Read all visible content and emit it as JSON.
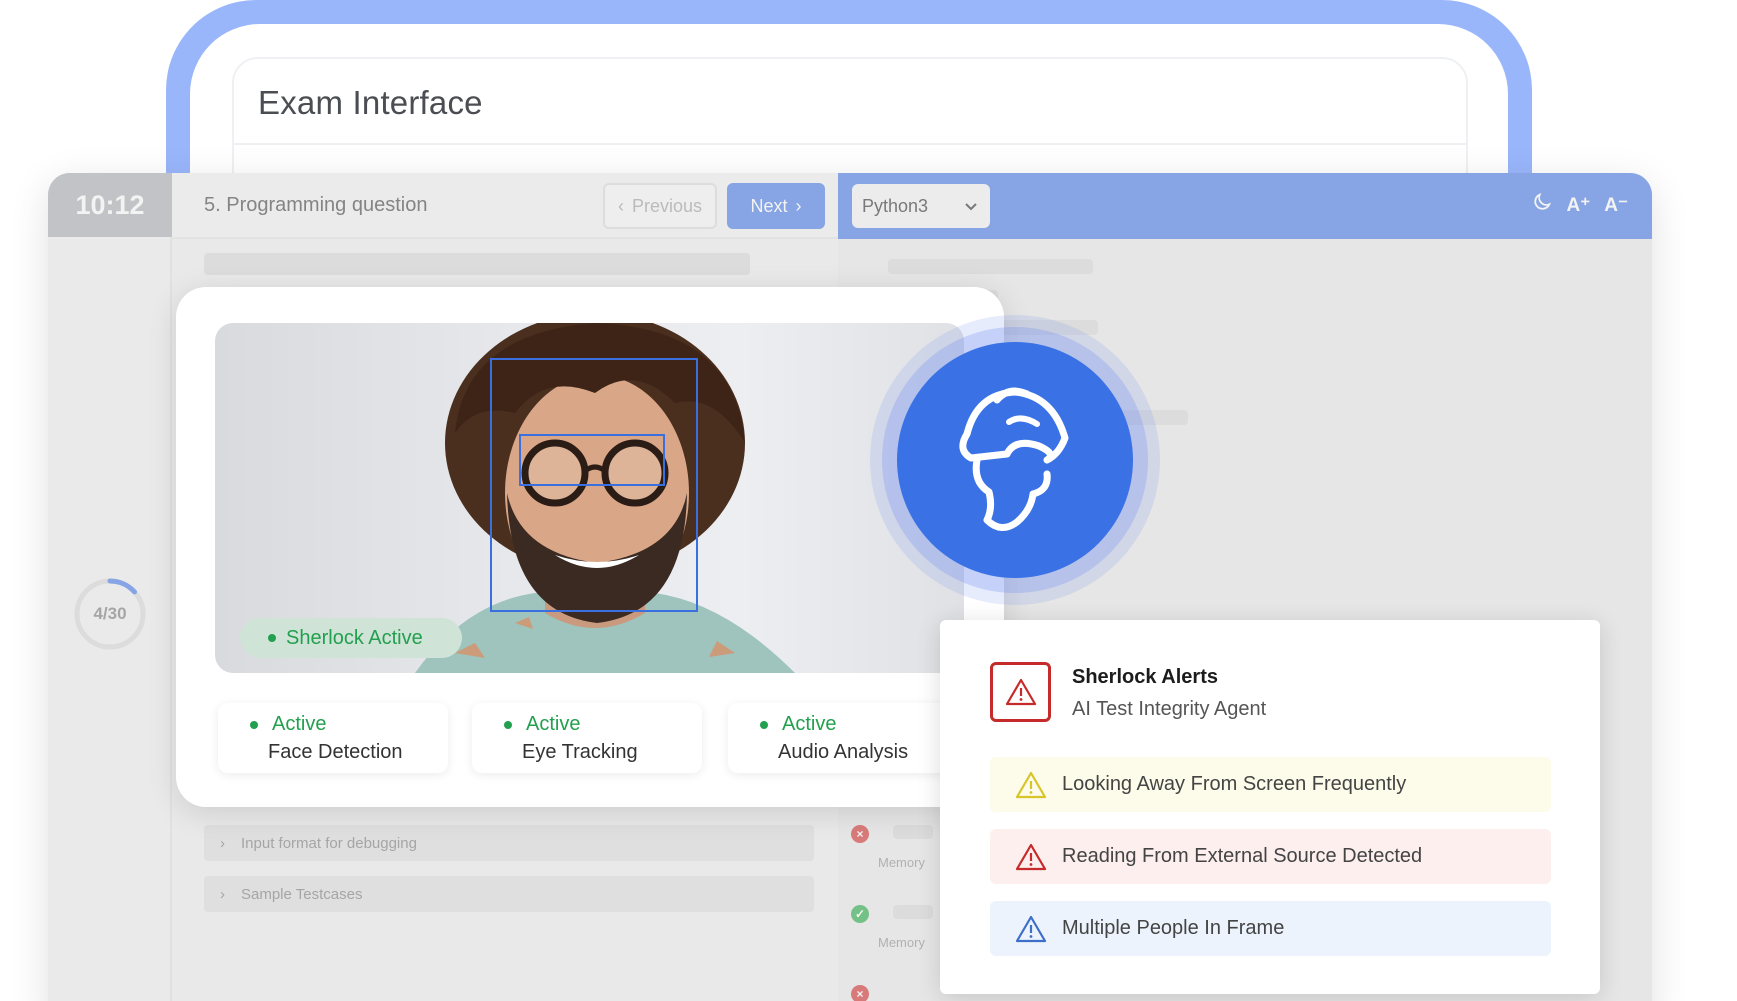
{
  "back_window": {
    "title": "Exam Interface"
  },
  "exam": {
    "timer": "10:12",
    "question_title": "5. Programming question",
    "prev_label": "Previous",
    "next_label": "Next",
    "language": "Python3",
    "font_increase": "A⁺",
    "font_decrease": "A⁻",
    "progress_label": "4/30",
    "progress_value": 0.133,
    "accordions": [
      "Input format for debugging",
      "Sample Testcases"
    ],
    "memory_label": "Memory"
  },
  "proctor": {
    "badge": "Sherlock Active",
    "stats": [
      {
        "status": "Active",
        "name": "Face Detection"
      },
      {
        "status": "Active",
        "name": "Eye Tracking"
      },
      {
        "status": "Active",
        "name": "Audio Analysis"
      }
    ]
  },
  "alerts": {
    "title": "Sherlock Alerts",
    "subtitle": "AI Test Integrity Agent",
    "items": [
      {
        "text": "Looking Away From Screen Frequently",
        "level": "warning",
        "color": "#d8c52a"
      },
      {
        "text": "Reading From External Source Detected",
        "level": "danger",
        "color": "#c62b2b"
      },
      {
        "text": "Multiple People In Frame",
        "level": "info",
        "color": "#3d6fc9"
      }
    ]
  },
  "colors": {
    "accent": "#5a88e8",
    "logo": "#3a72e6",
    "active": "#22a04f",
    "back_frame": "#9ab6fb"
  }
}
